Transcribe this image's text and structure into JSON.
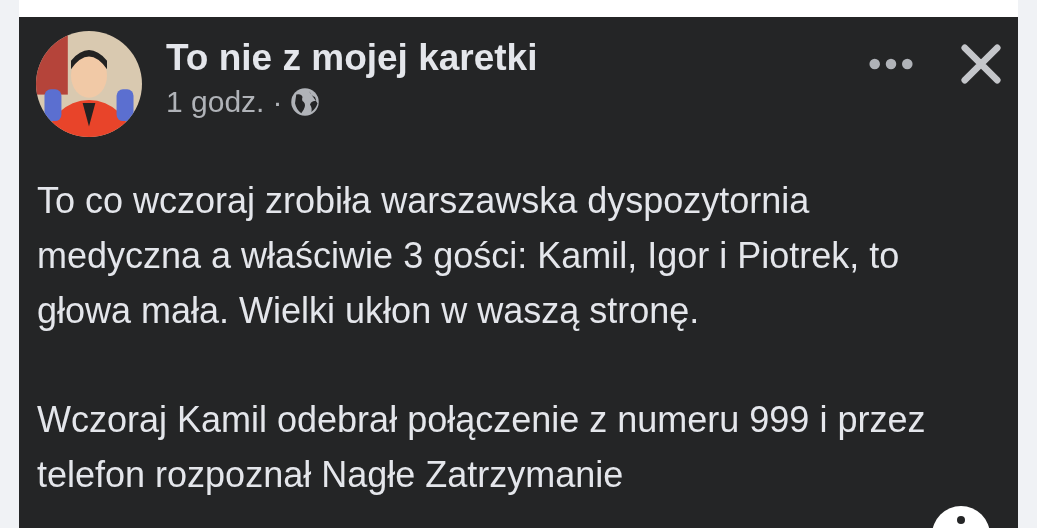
{
  "post": {
    "author": "To nie z mojej karetki",
    "time": "1 godz.",
    "separator": "·",
    "paragraphs": [
      "To co wczoraj zrobiła warszawska dyspozytornia medyczna a właściwie 3 gości: Kamil, Igor i Piotrek, to głowa mała. Wielki ukłon w waszą stronę.",
      "Wczoraj Kamil odebrał połączenie z numeru 999 i przez telefon rozpoznał Nagłe Zatrzymanie"
    ]
  }
}
